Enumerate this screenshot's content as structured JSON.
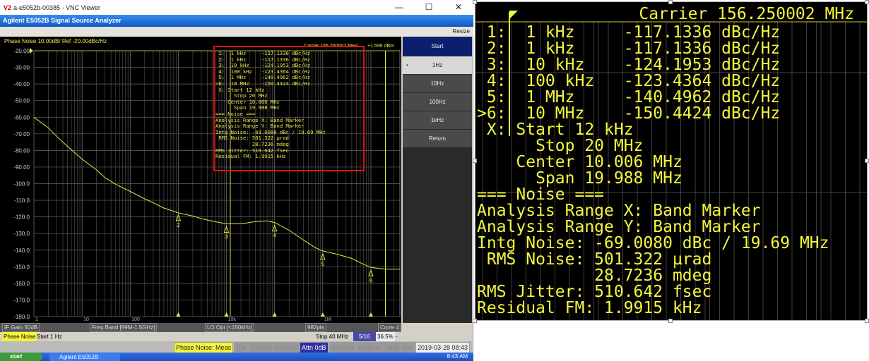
{
  "window": {
    "title": "a-e5052b-00385 - VNC Viewer",
    "logo": "V2",
    "minimize": "—",
    "maximize": "☐",
    "close": "✕"
  },
  "app": {
    "title": "Agilent E5052B Signal Source Analyzer",
    "resize": "Resize"
  },
  "trace_header": {
    "label": "Phase Noise 10.00dB/ Ref -20.00dBc/Hz",
    "carrier": "Carrier 156.250002 MHz",
    "power": "+1.596 dBm"
  },
  "softkeys": {
    "title": "Start",
    "items": [
      {
        "label": "1Hz",
        "selected": true
      },
      {
        "label": "10Hz"
      },
      {
        "label": "100Hz"
      },
      {
        "label": "1kHz"
      },
      {
        "label": "Return"
      }
    ]
  },
  "status_row1": {
    "if_gain": "IF Gain 50dB",
    "freq_band": "Freq Band [99M-1.5GHz]",
    "lo_opt": "LO Opt [<150kHz]",
    "points": "982pts",
    "corr": "Corre 4"
  },
  "status_row2": {
    "meas": "Phase Noise",
    "start": "Start 1 Hz",
    "stop": "Stop 40 MHz",
    "page": "5/16",
    "percent": "36.5%",
    "dash": "-"
  },
  "status_row3": {
    "meas_state": "Phase Noise: Meas",
    "items": [
      "Cor",
      "Ctrl OV",
      "Pow OV",
      "Attn 0dB",
      "ExtRef1",
      "ExtRef2",
      "Stop",
      "Svc"
    ],
    "datetime": "2019-03-28 08:43"
  },
  "taskbar": {
    "start": "start",
    "item": "Agilent E5052B Signal...",
    "clock": "8:43 AM"
  },
  "marker_table": {
    "carrier": "Carrier 156.250002 MHz",
    "lines": [
      " 1:  1 kHz     -117.1336 dBc/Hz",
      " 2:  1 kHz     -117.1336 dBc/Hz",
      " 3:  10 kHz    -124.1953 dBc/Hz",
      " 4:  100 kHz   -123.4364 dBc/Hz",
      " 5:  1 MHz     -140.4962 dBc/Hz",
      ">6:  10 MHz    -150.4424 dBc/Hz",
      " X: Start 12 kHz",
      "      Stop 20 MHz",
      "    Center 10.006 MHz",
      "      Span 19.988 MHz",
      "=== Noise ===",
      "Analysis Range X: Band Marker",
      "Analysis Range Y: Band Marker",
      "Intg Noise: -69.0080 dBc / 19.69 MHz",
      " RMS Noise: 501.322 µrad",
      "            28.7236 mdeg",
      "RMS Jitter: 510.642 fsec",
      "Residual FM: 1.9915 kHz"
    ]
  },
  "chart_data": {
    "type": "line",
    "title": "Phase Noise 10.00dB/ Ref -20.00dBc/Hz",
    "xscale": "log",
    "xlim": [
      1,
      40000000
    ],
    "ylim": [
      -180,
      -20
    ],
    "yticks": [
      -20,
      -30,
      -40,
      -50,
      -60,
      -70,
      -80,
      -90,
      -100,
      -110,
      -120,
      -130,
      -140,
      -150,
      -160,
      -170,
      -180
    ],
    "ytick_labels": [
      "-20.00",
      "-30.00",
      "-40.00",
      "-50.00",
      "-60.00",
      "-70.00",
      "-80.00",
      "-90.00",
      "-100.0",
      "-110.0",
      "-120.0",
      "-130.0",
      "-140.0",
      "-150.0",
      "-160.0",
      "-170.0",
      "-180.0"
    ],
    "xtick_labels": [
      {
        "x": 1,
        "label": "1"
      },
      {
        "x": 10,
        "label": "10"
      },
      {
        "x": 100,
        "label": "100"
      },
      {
        "x": 10000,
        "label": "10k"
      },
      {
        "x": 1000000,
        "label": "1M"
      }
    ],
    "trace_color": "#e8e84a",
    "series": [
      {
        "name": "Phase Noise",
        "x": [
          1,
          2,
          3,
          5,
          10,
          20,
          30,
          50,
          100,
          200,
          300,
          500,
          1000,
          2000,
          3000,
          5000,
          10000,
          20000,
          40000,
          70000,
          100000,
          200000,
          400000,
          700000,
          1000000,
          2000000,
          4000000,
          7000000,
          10000000,
          20000000,
          40000000
        ],
        "y": [
          -60,
          -66,
          -71,
          -77,
          -85,
          -92,
          -97,
          -101,
          -105,
          -109,
          -111,
          -114,
          -117.1,
          -119.5,
          -121,
          -122.5,
          -124.2,
          -124.2,
          -122.8,
          -122.4,
          -123.4,
          -128,
          -134,
          -138.5,
          -140.5,
          -142.5,
          -145,
          -148.5,
          -150.4,
          -151.5,
          -151.5
        ]
      }
    ],
    "markers": [
      {
        "id": "1",
        "x": 1000,
        "y": -117.1336
      },
      {
        "id": "2",
        "x": 1000,
        "y": -117.1336
      },
      {
        "id": "3",
        "x": 10000,
        "y": -124.1953
      },
      {
        "id": "4",
        "x": 100000,
        "y": -123.4364
      },
      {
        "id": "5",
        "x": 1000000,
        "y": -140.4962
      },
      {
        "id": "6",
        "x": 10000000,
        "y": -150.4424
      }
    ],
    "band_markers": {
      "start": 12000,
      "stop": 20000000
    }
  }
}
